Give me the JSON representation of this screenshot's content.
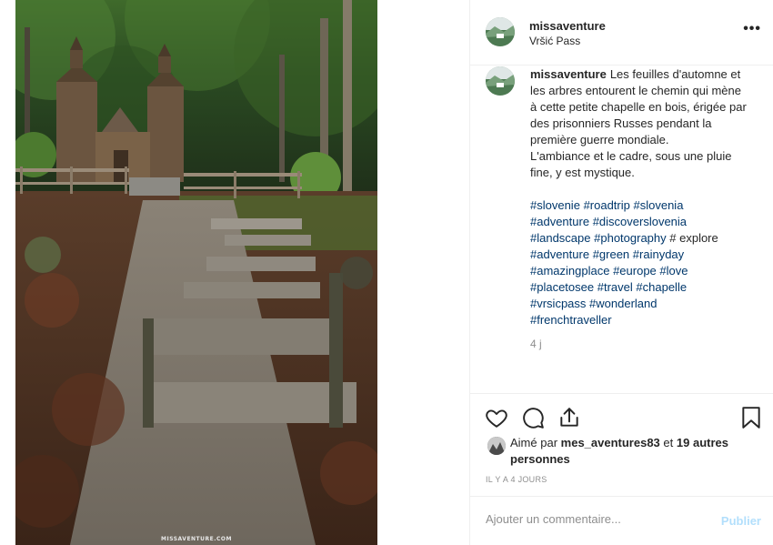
{
  "post": {
    "username": "missaventure",
    "location": "Vršić Pass",
    "more_label": "•••",
    "image_watermark": "MISSAVENTURE.COM"
  },
  "caption": {
    "username": "missaventure",
    "text_1": "Les feuilles d'automne et les arbres entourent le chemin qui mène à cette petite chapelle en bois, érigée par des prisonniers Russes pendant la première guerre mondiale.",
    "text_2": "L'ambiance et le cadre, sous une pluie fine, y est mystique.",
    "hashtags": [
      "#slovenie",
      "#roadtrip",
      "#slovenia",
      "#adventure",
      "#discoverslovenia",
      "#landscape",
      "#photography",
      "# explore",
      "#adventure",
      "#green",
      "#rainyday",
      "#amazingplace",
      "#europe",
      "#love",
      "#placetosee",
      "#travel",
      "#chapelle",
      "#vrsicpass",
      "#wonderland",
      "#frenchtraveller"
    ],
    "time": "4 j"
  },
  "actions": {
    "like_icon": "heart-icon",
    "comment_icon": "comment-icon",
    "share_icon": "share-icon",
    "save_icon": "bookmark-icon"
  },
  "likes": {
    "prefix": "Aimé par",
    "liker": "mes_aventures83",
    "connector": "et",
    "others": "19 autres personnes"
  },
  "posted_ago": "IL Y A 4 JOURS",
  "comment": {
    "placeholder": "Ajouter un commentaire...",
    "publish_label": "Publier"
  },
  "colors": {
    "hashtag": "#00376b",
    "publish_disabled": "#b2dffc",
    "secondary_text": "#8e8e8e"
  }
}
